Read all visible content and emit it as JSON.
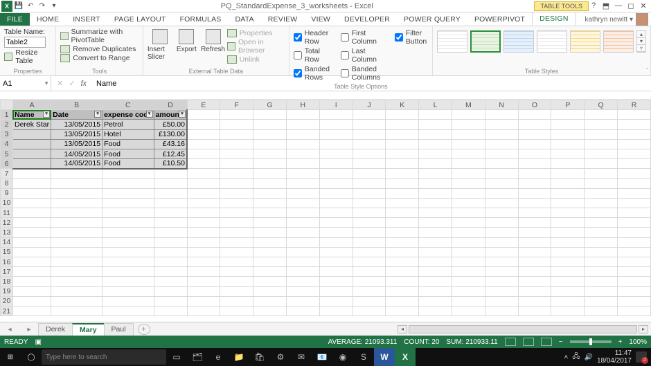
{
  "title": "PQ_StandardExpense_3_worksheets - Excel",
  "table_tools": "TABLE TOOLS",
  "user": "kathryn newitt",
  "tabs": [
    "FILE",
    "HOME",
    "INSERT",
    "PAGE LAYOUT",
    "FORMULAS",
    "DATA",
    "REVIEW",
    "VIEW",
    "DEVELOPER",
    "POWER QUERY",
    "POWERPIVOT",
    "DESIGN"
  ],
  "active_tab": 11,
  "ribbon": {
    "table_name_label": "Table Name:",
    "table_name": "Table2",
    "resize": "Resize Table",
    "group_props": "Properties",
    "pivot": "Summarize with PivotTable",
    "dup": "Remove Duplicates",
    "range": "Convert to Range",
    "group_tools": "Tools",
    "slicer": "Insert Slicer",
    "export": "Export",
    "refresh": "Refresh",
    "ext_props": "Properties",
    "ext_browser": "Open in Browser",
    "ext_unlink": "Unlink",
    "group_ext": "External Table Data",
    "opt_header": "Header Row",
    "opt_total": "Total Row",
    "opt_brows": "Banded Rows",
    "opt_first": "First Column",
    "opt_last": "Last Column",
    "opt_bcols": "Banded Columns",
    "opt_filter": "Filter Button",
    "group_opts": "Table Style Options",
    "group_styles": "Table Styles"
  },
  "namebox": "A1",
  "formula": "Name",
  "columns": [
    "A",
    "B",
    "C",
    "D",
    "E",
    "F",
    "G",
    "H",
    "I",
    "J",
    "K",
    "L",
    "M",
    "N",
    "O",
    "P",
    "Q",
    "R"
  ],
  "headers": {
    "A": "Name",
    "B": "Date",
    "C": "expense code",
    "D": "amount"
  },
  "rows": [
    {
      "A": "Derek Star",
      "B": "13/05/2015",
      "C": "Petrol",
      "D": "£50.00"
    },
    {
      "A": "",
      "B": "13/05/2015",
      "C": "Hotel",
      "D": "£130.00"
    },
    {
      "A": "",
      "B": "13/05/2015",
      "C": "Food",
      "D": "£43.16"
    },
    {
      "A": "",
      "B": "14/05/2015",
      "C": "Food",
      "D": "£12.45"
    },
    {
      "A": "",
      "B": "14/05/2015",
      "C": "Food",
      "D": "£10.50"
    }
  ],
  "sheets": [
    "Derek",
    "Mary",
    "Paul"
  ],
  "active_sheet": 1,
  "status": {
    "ready": "READY",
    "avg_label": "AVERAGE:",
    "avg": "21093.311",
    "count_label": "COUNT:",
    "count": "20",
    "sum_label": "SUM:",
    "sum": "210933.11",
    "zoom": "100%"
  },
  "taskbar": {
    "search_placeholder": "Type here to search",
    "time": "11:47",
    "date": "18/04/2017",
    "notif": "2"
  }
}
